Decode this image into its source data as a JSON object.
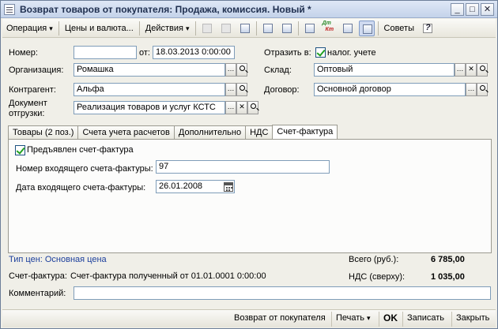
{
  "window": {
    "title": "Возврат товаров от покупателя: Продажа, комиссия. Новый *"
  },
  "toolbar": {
    "operation": "Операция",
    "prices_currency": "Цены и валюта...",
    "actions": "Действия",
    "advice": "Советы"
  },
  "header": {
    "number_label": "Номер:",
    "number_value": "",
    "date_label": "от:",
    "date_value": "18.03.2013  0:00:00",
    "reflect_label": "Отразить в:",
    "reflect_tax": "налог. учете",
    "org_label": "Организация:",
    "org_value": "Ромашка",
    "warehouse_label": "Склад:",
    "warehouse_value": "Оптовый",
    "contractor_label": "Контрагент:",
    "contractor_value": "Альфа",
    "contract_label": "Договор:",
    "contract_value": "Основной договор",
    "ship_doc_label_1": "Документ",
    "ship_doc_label_2": "отгрузки:",
    "ship_doc_value": "Реализация товаров и услуг КСТС"
  },
  "tabs": [
    "Товары (2 поз.)",
    "Счета учета расчетов",
    "Дополнительно",
    "НДС",
    "Счет-фактура"
  ],
  "invoice_tab": {
    "presented_label": "Предъявлен счет-фактура",
    "incoming_number_label": "Номер входящего счета-фактуры:",
    "incoming_number_value": "97",
    "incoming_date_label": "Дата входящего счета-фактуры:",
    "incoming_date_value": "26.01.2008"
  },
  "footer": {
    "price_type": "Тип цен: Основная цена",
    "total_label": "Всего (руб.):",
    "total_value": "6 785,00",
    "invoice_label": "Счет-фактура:",
    "invoice_value": "Счет-фактура полученный  от 01.01.0001 0:00:00",
    "vat_label": "НДС (сверху):",
    "vat_value": "1 035,00",
    "comment_label": "Комментарий:",
    "comment_value": ""
  },
  "bottom_buttons": {
    "return": "Возврат от покупателя",
    "print": "Печать",
    "ok": "OK",
    "save": "Записать",
    "close": "Закрыть"
  },
  "icons": [
    "document-icon",
    "minimize-icon",
    "maximize-icon",
    "close-icon",
    "dt-kt-icon",
    "help-icon",
    "calendar-icon",
    "magnifier-icon"
  ]
}
